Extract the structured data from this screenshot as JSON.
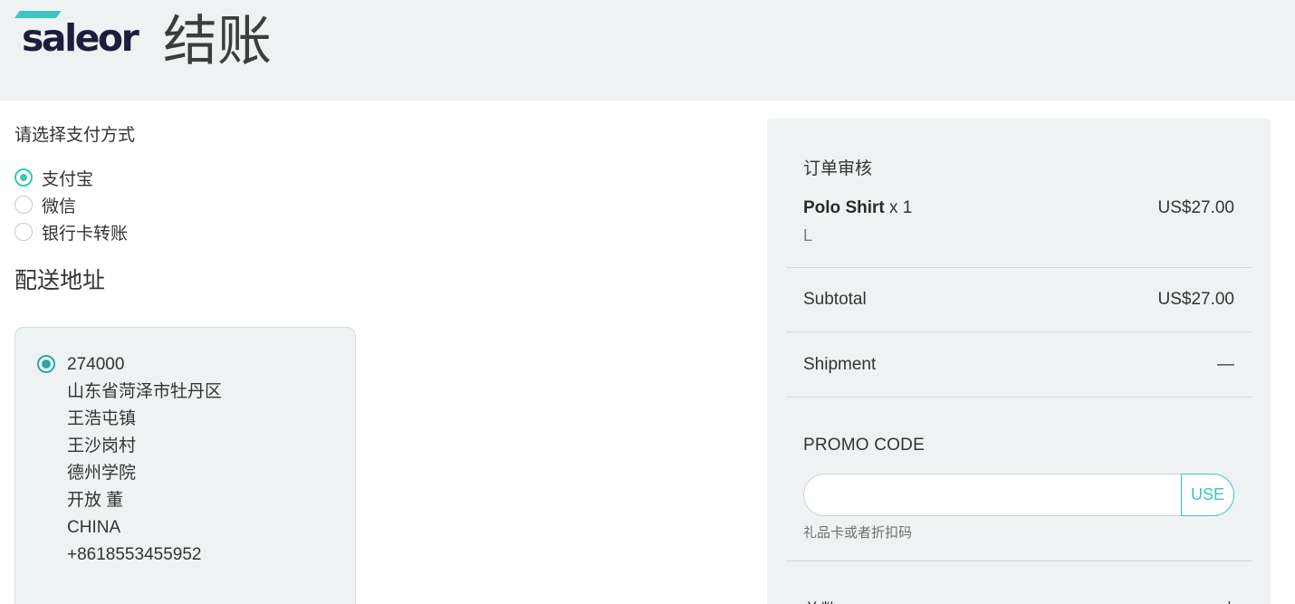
{
  "header": {
    "logo_text": "saleor",
    "title": "结账"
  },
  "payment": {
    "title": "请选择支付方式",
    "options": [
      {
        "label": "支付宝",
        "selected": true
      },
      {
        "label": "微信",
        "selected": false
      },
      {
        "label": "银行卡转账",
        "selected": false
      }
    ]
  },
  "shipping": {
    "title": "配送地址",
    "address": {
      "selected": true,
      "lines": [
        "274000",
        "山东省菏泽市牡丹区",
        "王浩屯镇",
        "王沙岗村",
        "德州学院",
        "开放 董",
        "CHINA",
        "+8618553455952"
      ]
    }
  },
  "summary": {
    "title": "订单审核",
    "item": {
      "name": "Polo Shirt",
      "qty": "x 1",
      "variant": "L",
      "price": "US$27.00"
    },
    "subtotal_label": "Subtotal",
    "subtotal_value": "US$27.00",
    "shipment_label": "Shipment",
    "shipment_value": "—",
    "promo": {
      "label": "PROMO CODE",
      "value": "",
      "button": "USE",
      "help": "礼品卡或者折扣码"
    },
    "total_label": "总数",
    "total_value": "+"
  },
  "colors": {
    "accent": "#3ac6bf",
    "header_bg": "#eff2f3",
    "logo": "#1f1d3d"
  }
}
